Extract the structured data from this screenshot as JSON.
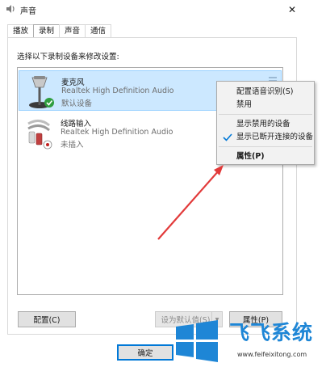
{
  "window": {
    "title": "声音",
    "close_label": "✕"
  },
  "tabs": [
    {
      "label": "播放"
    },
    {
      "label": "录制"
    },
    {
      "label": "声音"
    },
    {
      "label": "通信"
    }
  ],
  "instruction": "选择以下录制设备来修改设置:",
  "devices": [
    {
      "name": "麦克风",
      "driver": "Realtek High Definition Audio",
      "status": "默认设备",
      "icon": "microphone-icon",
      "selected": true
    },
    {
      "name": "线路输入",
      "driver": "Realtek High Definition Audio",
      "status": "未插入",
      "icon": "line-in-icon",
      "selected": false
    }
  ],
  "context_menu": {
    "items": [
      {
        "label": "配置语音识别(S)"
      },
      {
        "label": "禁用"
      },
      {
        "label": "显示禁用的设备"
      },
      {
        "label": "显示已断开连接的设备",
        "checked": true
      },
      {
        "label": "属性(P)",
        "bold": true
      }
    ]
  },
  "buttons": {
    "configure": "配置(C)",
    "set_default": "设为默认值(S)",
    "dropdown": "▾",
    "properties": "属性(P)",
    "ok": "确定"
  },
  "watermark": {
    "title": "飞飞系统",
    "url": "www.feifeixitong.com"
  },
  "colors": {
    "selection": "#cce8ff",
    "accent": "#0078d7",
    "arrow": "#e23a3a",
    "watermark_blue": "#1e86d6"
  }
}
